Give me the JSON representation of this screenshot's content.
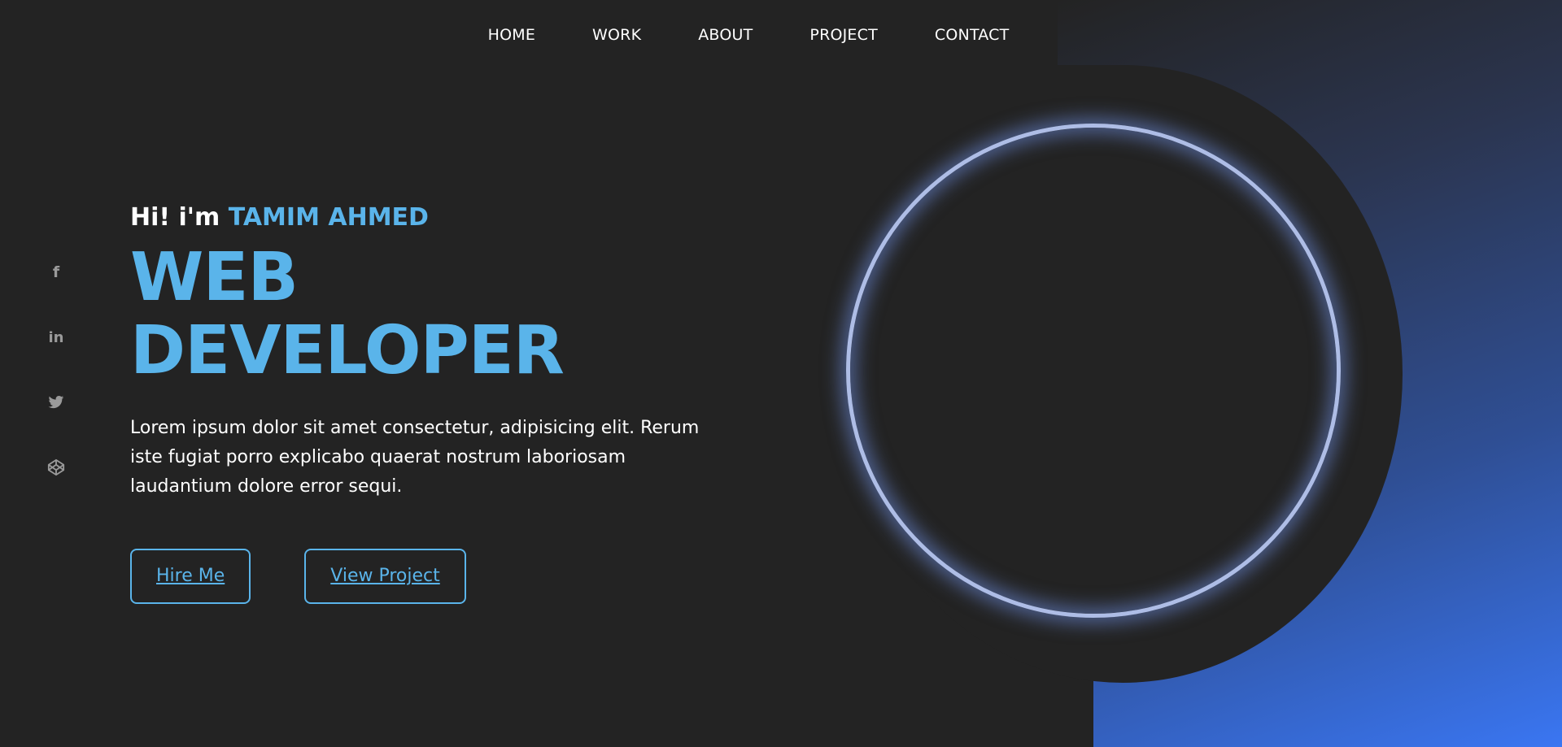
{
  "nav": {
    "items": [
      {
        "label": "HOME"
      },
      {
        "label": "WORK"
      },
      {
        "label": "ABOUT"
      },
      {
        "label": "PROJECT"
      },
      {
        "label": "CONTACT"
      }
    ]
  },
  "social": {
    "icons": [
      "facebook-icon",
      "linkedin-icon",
      "twitter-icon",
      "codepen-icon"
    ],
    "facebook_glyph": "f",
    "linkedin_glyph": "in"
  },
  "hero": {
    "greeting": "Hi! i'm",
    "name": "TAMIM AHMED",
    "role": "WEB DEVELOPER",
    "description": "Lorem ipsum dolor sit amet consectetur, adipisicing elit. Rerum iste fugiat porro explicabo quaerat nostrum laboriosam laudantium dolore error sequi.",
    "hire_label": "Hire Me",
    "view_project_label": "View Project"
  },
  "colors": {
    "accent": "#5ab4ea",
    "background": "#232323",
    "gradient_end": "#3a76f2",
    "ring": "#aebde6"
  }
}
